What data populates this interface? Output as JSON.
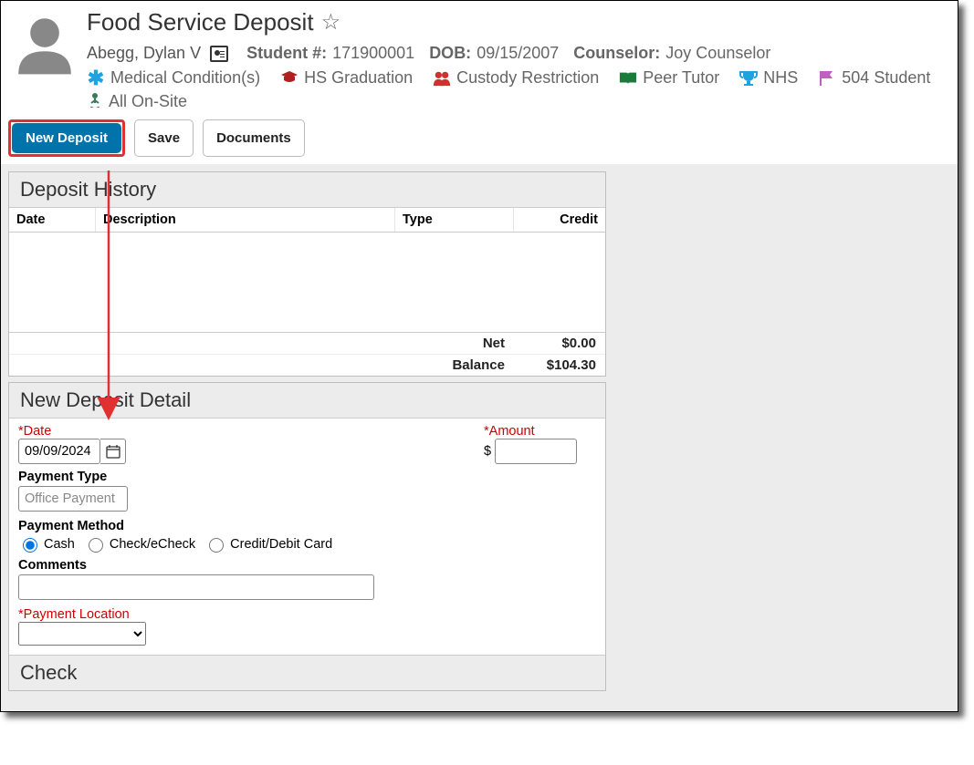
{
  "page": {
    "title": "Food Service Deposit"
  },
  "student": {
    "name": "Abegg, Dylan V",
    "number_label": "Student #:",
    "number": "171900001",
    "dob_label": "DOB:",
    "dob": "09/15/2007",
    "counselor_label": "Counselor:",
    "counselor": "Joy Counselor"
  },
  "flags": {
    "medical": "Medical Condition(s)",
    "hs_grad": "HS Graduation",
    "custody": "Custody Restriction",
    "peer_tutor": "Peer Tutor",
    "nhs": "NHS",
    "student_504": "504 Student"
  },
  "status": {
    "onsite": "All On-Site"
  },
  "toolbar": {
    "new_deposit": "New Deposit",
    "save": "Save",
    "documents": "Documents"
  },
  "deposit_history": {
    "title": "Deposit History",
    "cols": {
      "date": "Date",
      "desc": "Description",
      "type": "Type",
      "credit": "Credit"
    },
    "net_label": "Net",
    "net_value": "$0.00",
    "balance_label": "Balance",
    "balance_value": "$104.30"
  },
  "detail": {
    "title": "New Deposit Detail",
    "date_label": "*Date",
    "date_value": "09/09/2024",
    "amount_label": "*Amount",
    "amount_prefix": "$",
    "amount_value": "",
    "payment_type_label": "Payment Type",
    "payment_type_value": "Office Payment",
    "payment_method_label": "Payment Method",
    "pm_cash": "Cash",
    "pm_check": "Check/eCheck",
    "pm_card": "Credit/Debit Card",
    "comments_label": "Comments",
    "comments_value": "",
    "ploc_label": "*Payment Location",
    "ploc_value": "",
    "check_section": "Check"
  }
}
